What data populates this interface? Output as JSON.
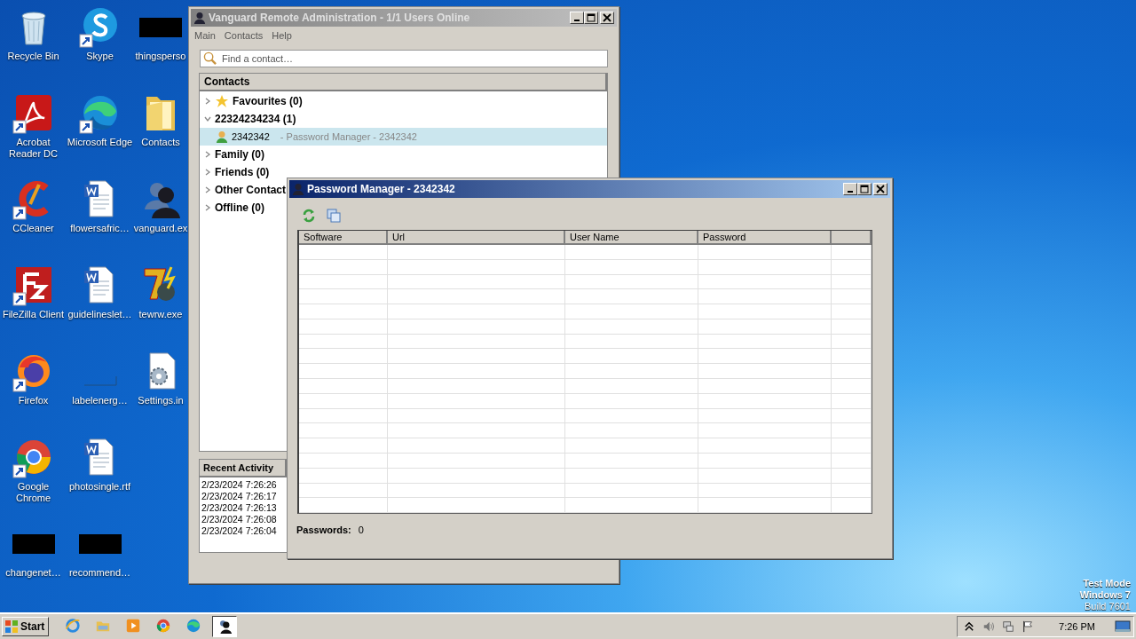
{
  "desktop": {
    "icons": [
      {
        "label": "Recycle Bin",
        "kind": "recycle"
      },
      {
        "label": "Acrobat Reader DC",
        "kind": "acrobat"
      },
      {
        "label": "CCleaner",
        "kind": "ccleaner"
      },
      {
        "label": "FileZilla Client",
        "kind": "filezilla"
      },
      {
        "label": "Firefox",
        "kind": "firefox"
      },
      {
        "label": "Google Chrome",
        "kind": "chrome"
      },
      {
        "label": "changenet…",
        "kind": "redacted"
      },
      {
        "label": "Skype",
        "kind": "skype"
      },
      {
        "label": "Microsoft Edge",
        "kind": "edge"
      },
      {
        "label": "flowersafric…",
        "kind": "document"
      },
      {
        "label": "guidelineslet…",
        "kind": "document"
      },
      {
        "label": "labelenerg…",
        "kind": "blank"
      },
      {
        "label": "photosingle.rtf",
        "kind": "document"
      },
      {
        "label": "recommend…",
        "kind": "redacted"
      },
      {
        "label": "thingsperso",
        "kind": "redacted"
      },
      {
        "label": "Contacts",
        "kind": "folder"
      },
      {
        "label": "vanguard.ex",
        "kind": "user"
      },
      {
        "label": "tewrw.exe",
        "kind": "seven"
      },
      {
        "label": "Settings.in",
        "kind": "settings"
      }
    ]
  },
  "test_mode": {
    "title": "Test Mode",
    "edition": "Windows 7",
    "build": "Build 7601"
  },
  "vanguard_window": {
    "title": "Vanguard Remote Administration - 1/1 Users Online",
    "active": false,
    "menu": [
      "Main",
      "Contacts",
      "Help"
    ],
    "search": {
      "placeholder": "Find a contact…"
    },
    "contacts": {
      "header": "Contacts",
      "groups": [
        {
          "label": "Favourites (0)",
          "kind": "favourites",
          "expanded": false
        },
        {
          "label": "22324234234 (1)",
          "kind": "group",
          "expanded": true,
          "children": [
            {
              "name": "2342342",
              "status": "- Password Manager - 2342342",
              "selected": true
            }
          ]
        },
        {
          "label": "Family (0)",
          "kind": "group",
          "expanded": false
        },
        {
          "label": "Friends (0)",
          "kind": "group",
          "expanded": false
        },
        {
          "label": "Other Contact",
          "kind": "group",
          "expanded": false
        },
        {
          "label": "Offline (0)",
          "kind": "group",
          "expanded": false
        }
      ]
    },
    "recent_activity": {
      "header": "Recent Activity",
      "entries": [
        "2/23/2024 7:26:26",
        "2/23/2024 7:26:17",
        "2/23/2024 7:26:13",
        "2/23/2024 7:26:08",
        "2/23/2024 7:26:04"
      ]
    }
  },
  "password_window": {
    "title": "Password Manager - 2342342",
    "active": true,
    "columns": [
      "Software",
      "Url",
      "User Name",
      "Password"
    ],
    "footer": {
      "label": "Passwords:",
      "value": "0"
    }
  },
  "taskbar": {
    "start": "Start",
    "pinned": [
      {
        "kind": "ie",
        "active": false
      },
      {
        "kind": "explorer",
        "active": false
      },
      {
        "kind": "media",
        "active": false
      },
      {
        "kind": "chrome",
        "active": false
      },
      {
        "kind": "edge",
        "active": false
      },
      {
        "kind": "user",
        "active": true
      }
    ],
    "clock": "7:26 PM"
  }
}
